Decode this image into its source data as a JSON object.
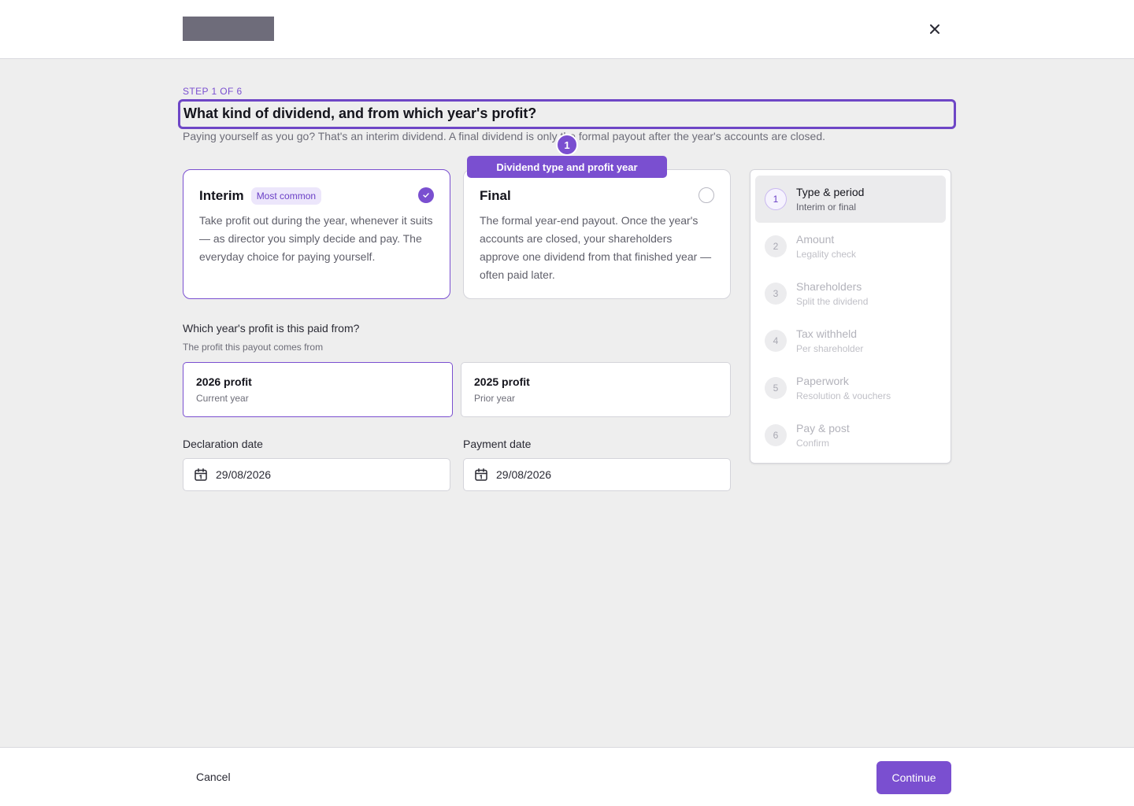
{
  "header": {
    "close_label": "×"
  },
  "wizard": {
    "step_label": "STEP 1 OF 6",
    "title": "What kind of dividend, and from which year's profit?",
    "subtitle": "Paying yourself as you go? That's an interim dividend. A final dividend is only the formal payout after the year's accounts are closed."
  },
  "tour": {
    "badge": "1",
    "tooltip": "Dividend type and profit year"
  },
  "dividend_types": [
    {
      "title": "Interim",
      "pill": "Most common",
      "description": "Take profit out during the year, whenever it suits — as director you simply decide and pay. The everyday choice for paying yourself.",
      "selected": true
    },
    {
      "title": "Final",
      "description": "The formal year-end payout. Once the year's accounts are closed, your shareholders approve one dividend from that finished year — often paid later.",
      "selected": false
    }
  ],
  "profit_year": {
    "question": "Which year's profit is this paid from?",
    "hint": "The profit this payout comes from",
    "options": [
      {
        "title": "2026 profit",
        "sub": "Current year",
        "selected": true
      },
      {
        "title": "2025 profit",
        "sub": "Prior year",
        "selected": false
      }
    ]
  },
  "dates": {
    "declaration_label": "Declaration date",
    "declaration_value": "29/08/2026",
    "payment_label": "Payment date",
    "payment_value": "29/08/2026"
  },
  "steps": [
    {
      "num": "1",
      "name": "Type & period",
      "desc": "Interim or final",
      "active": true
    },
    {
      "num": "2",
      "name": "Amount",
      "desc": "Legality check",
      "active": false
    },
    {
      "num": "3",
      "name": "Shareholders",
      "desc": "Split the dividend",
      "active": false
    },
    {
      "num": "4",
      "name": "Tax withheld",
      "desc": "Per shareholder",
      "active": false
    },
    {
      "num": "5",
      "name": "Paperwork",
      "desc": "Resolution & vouchers",
      "active": false
    },
    {
      "num": "6",
      "name": "Pay & post",
      "desc": "Confirm",
      "active": false
    }
  ],
  "footer": {
    "cancel_label": "Cancel",
    "continue_label": "Continue"
  },
  "colors": {
    "accent": "#7a4fd0",
    "background": "#eeeeee"
  }
}
